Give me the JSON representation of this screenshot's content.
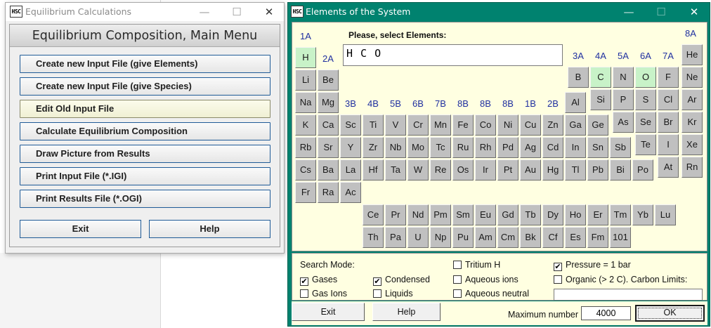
{
  "window1": {
    "app_icon_text": "HSC",
    "title": "Equilibrium Calculations",
    "minimize": "—",
    "maximize": "☐",
    "close": "✕",
    "header": "Equilibrium Composition, Main Menu",
    "menu_items": [
      "Create new Input File (give Elements)",
      "Create new Input File (give Species)",
      "Edit Old Input File",
      "Calculate Equilibrium Composition",
      "Draw Picture from Results",
      "Print Input File (*.IGI)",
      "Print Results File (*.OGI)"
    ],
    "exit_label": "Exit",
    "help_label": "Help"
  },
  "window2": {
    "app_icon_text": "HSC",
    "title": "Elements of the System",
    "minimize": "—",
    "maximize": "☐",
    "close": "✕",
    "prompt": "Please, select Elements:",
    "formula": "H C O",
    "groups": {
      "g1A": "1A",
      "g2A": "2A",
      "g3B": "3B",
      "g4B": "4B",
      "g5B": "5B",
      "g6B": "6B",
      "g7B": "7B",
      "g8B_a": "8B",
      "g8B_b": "8B",
      "g8B_c": "8B",
      "g1B": "1B",
      "g2B": "2B",
      "g3A": "3A",
      "g4A": "4A",
      "g5A": "5A",
      "g6A": "6A",
      "g7A": "7A",
      "g8A": "8A"
    },
    "elements": {
      "H": "H",
      "He": "He",
      "Li": "Li",
      "Be": "Be",
      "B": "B",
      "C": "C",
      "N": "N",
      "O": "O",
      "F": "F",
      "Ne": "Ne",
      "Na": "Na",
      "Mg": "Mg",
      "Al": "Al",
      "Si": "Si",
      "P": "P",
      "S": "S",
      "Cl": "Cl",
      "Ar": "Ar",
      "K": "K",
      "Ca": "Ca",
      "Sc": "Sc",
      "Ti": "Ti",
      "V": "V",
      "Cr": "Cr",
      "Mn": "Mn",
      "Fe": "Fe",
      "Co": "Co",
      "Ni": "Ni",
      "Cu": "Cu",
      "Zn": "Zn",
      "Ga": "Ga",
      "Ge": "Ge",
      "As": "As",
      "Se": "Se",
      "Br": "Br",
      "Kr": "Kr",
      "Rb": "Rb",
      "Sr": "Sr",
      "Y": "Y",
      "Zr": "Zr",
      "Nb": "Nb",
      "Mo": "Mo",
      "Tc": "Tc",
      "Ru": "Ru",
      "Rh": "Rh",
      "Pd": "Pd",
      "Ag": "Ag",
      "Cd": "Cd",
      "In": "In",
      "Sn": "Sn",
      "Sb": "Sb",
      "Te": "Te",
      "I": "I",
      "Xe": "Xe",
      "Cs": "Cs",
      "Ba": "Ba",
      "La": "La",
      "Hf": "Hf",
      "Ta": "Ta",
      "W": "W",
      "Re": "Re",
      "Os": "Os",
      "Ir": "Ir",
      "Pt": "Pt",
      "Au": "Au",
      "Hg": "Hg",
      "Tl": "Tl",
      "Pb": "Pb",
      "Bi": "Bi",
      "Po": "Po",
      "At": "At",
      "Rn": "Rn",
      "Fr": "Fr",
      "Ra": "Ra",
      "Ac": "Ac",
      "Ce": "Ce",
      "Pr": "Pr",
      "Nd": "Nd",
      "Pm": "Pm",
      "Sm": "Sm",
      "Eu": "Eu",
      "Gd": "Gd",
      "Tb": "Tb",
      "Dy": "Dy",
      "Ho": "Ho",
      "Er": "Er",
      "Tm": "Tm",
      "Yb": "Yb",
      "Lu": "Lu",
      "Th": "Th",
      "Pa": "Pa",
      "U": "U",
      "Np": "Np",
      "Pu": "Pu",
      "Am": "Am",
      "Cm": "Cm",
      "Bk": "Bk",
      "Cf": "Cf",
      "Es": "Es",
      "Fm": "Fm",
      "E101": "101"
    },
    "selected_elements": [
      "H",
      "C",
      "O"
    ],
    "search": {
      "mode_label": "Search Mode:",
      "tritium_label": "Tritium H",
      "pressure_label": "Pressure = 1 bar",
      "gases_label": "Gases",
      "condensed_label": "Condensed",
      "aqueous_ions_label": "Aqueous ions",
      "organic_label": "Organic (> 2 C). Carbon Limits:",
      "gas_ions_label": "Gas Ions",
      "liquids_label": "Liquids",
      "aqueous_neutral_label": "Aqueous neutral",
      "check_mark": "✔",
      "tritium_checked": false,
      "pressure_checked": true,
      "gases_checked": true,
      "condensed_checked": true,
      "aqueous_ions_checked": false,
      "organic_checked": false,
      "gas_ions_checked": false,
      "liquids_checked": false,
      "aqueous_neutral_checked": false
    },
    "exit_label": "Exit",
    "help_label": "Help",
    "max_number_label": "Maximum number",
    "max_number_value": "4000",
    "ok_label": "OK"
  },
  "colors": {
    "dialog_titlebar": "#00826f",
    "panel_background": "#ffffe1",
    "selected_element": "#c8f2c8",
    "element_button": "#c0c0c0",
    "group_label": "#1f2fa0",
    "button_border": "#1f5b97"
  }
}
